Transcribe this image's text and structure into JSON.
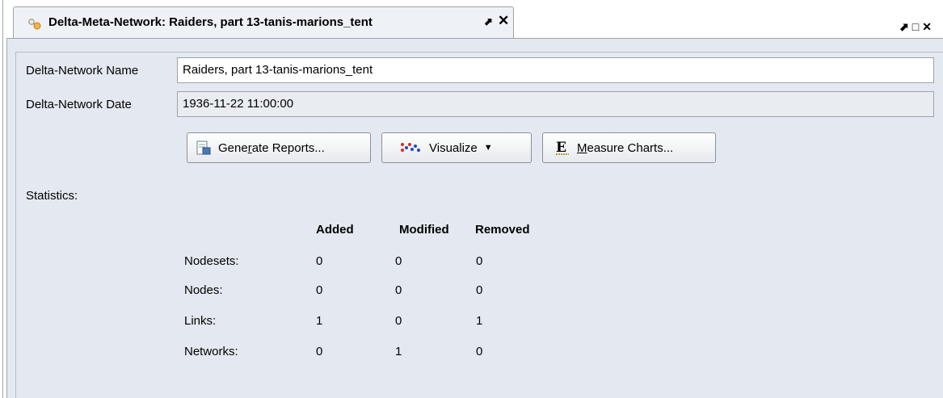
{
  "tab": {
    "title": "Delta-Meta-Network: Raiders, part 13-tanis-marions_tent",
    "pin_glyph": "⬈",
    "close_glyph": "✕"
  },
  "window_controls": {
    "pin": "⬈",
    "maximize": "□",
    "close": "✕"
  },
  "form": {
    "name_label": "Delta-Network Name",
    "name_value": "Raiders, part 13-tanis-marions_tent",
    "date_label": "Delta-Network Date",
    "date_value": "1936-11-22 11:00:00"
  },
  "buttons": {
    "generate_reports": {
      "before": "Gene",
      "mnemonic": "r",
      "after": "ate Reports..."
    },
    "visualize": {
      "label": "Visualize",
      "arrow": "▼"
    },
    "measure_charts": {
      "before": "",
      "mnemonic": "M",
      "after": "easure Charts..."
    }
  },
  "statistics": {
    "label": "Statistics:",
    "columns": [
      "Added",
      "Modified",
      "Removed"
    ],
    "rows": [
      {
        "label": "Nodesets:",
        "values": [
          "0",
          "0",
          "0"
        ]
      },
      {
        "label": "Nodes:",
        "values": [
          "0",
          "0",
          "0"
        ]
      },
      {
        "label": "Links:",
        "values": [
          "1",
          "0",
          "1"
        ]
      },
      {
        "label": "Networks:",
        "values": [
          "0",
          "1",
          "0"
        ]
      }
    ]
  },
  "colors": {
    "panel_bg": "#e4e9f1",
    "tab_bg": "#eef1f6",
    "border": "#9ea3ab"
  }
}
